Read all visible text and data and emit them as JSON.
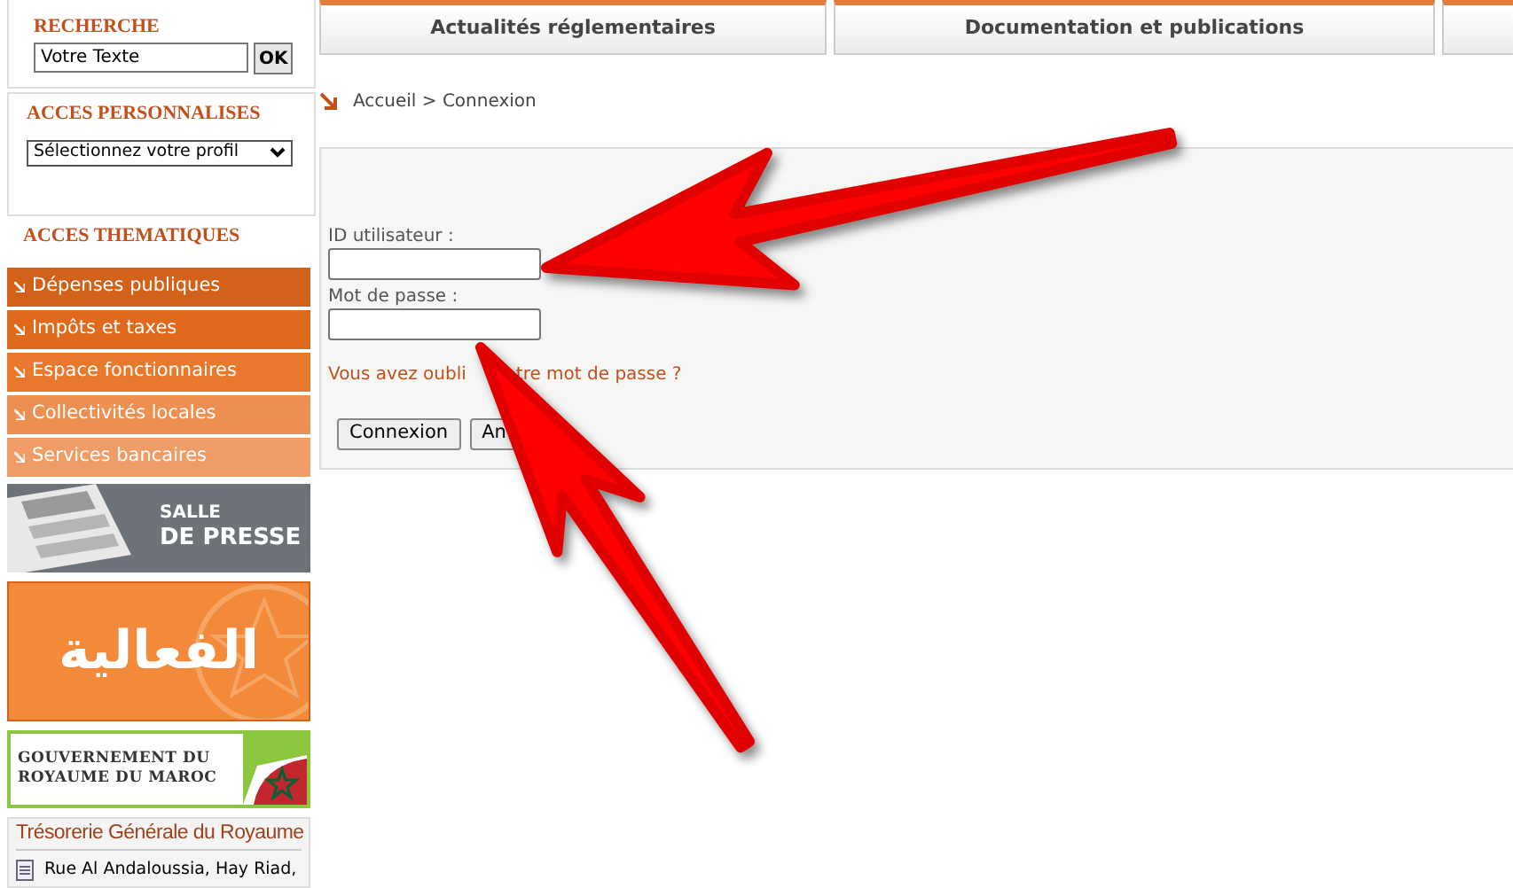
{
  "search": {
    "title": "RECHERCHE",
    "value": "Votre Texte",
    "button": "OK"
  },
  "personal": {
    "title": "ACCES PERSONNALISES",
    "select": "Sélectionnez votre profil"
  },
  "thematic": {
    "title": "ACCES THEMATIQUES",
    "items": [
      {
        "label": "Dépenses publiques",
        "color": "#d2621a"
      },
      {
        "label": "Impôts et taxes",
        "color": "#e06a1c"
      },
      {
        "label": "Espace fonctionnaires",
        "color": "#e8782c"
      },
      {
        "label": "Collectivités locales",
        "color": "#ee8f52"
      },
      {
        "label": "Services bancaires",
        "color": "#f09c66"
      }
    ]
  },
  "banners": [
    {
      "kind": "press",
      "line1": "SALLE",
      "line2": "DE PRESSE"
    },
    {
      "kind": "arabic",
      "text": "الفعالية"
    },
    {
      "kind": "government",
      "line1": "GOUVERNEMENT DU",
      "line2": "ROYAUME DU MAROC"
    }
  ],
  "treasury": {
    "title": "Trésorerie Générale du Royaume",
    "address": "Rue Al Andaloussia, Hay Riad,"
  },
  "nav_tabs": [
    "Actualités réglementaires",
    "Documentation et publications"
  ],
  "breadcrumb": "Accueil > Connexion",
  "login": {
    "user_label": "ID utilisateur :",
    "password_label": "Mot de passe :",
    "forgot_link": [
      "Vous avez oubli",
      "tre mot de passe ?"
    ],
    "buttons": [
      "Connexion",
      "An"
    ]
  }
}
